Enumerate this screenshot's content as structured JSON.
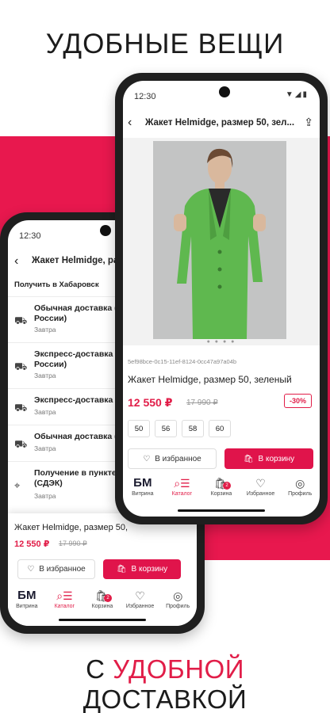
{
  "headline_top": "УДОБНЫЕ ВЕЩИ",
  "headline_bottom": {
    "prefix": "С ",
    "accent": "УДОБНОЙ",
    "suffix": " ДОСТАВКОЙ"
  },
  "colors": {
    "accent": "#e11d48",
    "band": "#e8184e"
  },
  "back_phone": {
    "time": "12:30",
    "title": "Жакет Helmidge, раз",
    "city": "Получить в Хабаровск",
    "delivery": [
      {
        "name": "Обычная доставка (\nРоссии)",
        "when": "Завтра",
        "icon": "truck-icon"
      },
      {
        "name": "Экспресс-доставка\nРоссии)",
        "when": "Завтра",
        "icon": "truck-icon"
      },
      {
        "name": "Экспресс-доставка",
        "when": "Завтра",
        "icon": "truck-icon"
      },
      {
        "name": "Обычная доставка (",
        "when": "Завтра",
        "icon": "truck-icon"
      },
      {
        "name": "Получение в пункте\n(СДЭК)",
        "when": "Завтра",
        "icon": "location-pin-icon"
      }
    ],
    "product_title": "Жакет Helmidge, размер 50,",
    "price": "12 550 ₽",
    "old_price": "17 990 ₽",
    "fav_label": "В избранное",
    "cart_label": "В корзину"
  },
  "front_phone": {
    "time": "12:30",
    "title": "Жакет Helmidge, размер 50, зел...",
    "sku": "5ef98bce-0c15-11ef-8124-0cc47a97a04b",
    "product_title": "Жакет Helmidge, размер 50, зеленый",
    "price": "12 550 ₽",
    "old_price": "17 990 ₽",
    "discount": "-30%",
    "sizes": [
      "50",
      "56",
      "58",
      "60"
    ],
    "fav_label": "В избранное",
    "cart_label": "В корзину"
  },
  "tabs": {
    "vitrina": "Витрина",
    "catalog": "Каталог",
    "cart": "Корзина",
    "cart_badge": "2",
    "favorites": "Избранное",
    "profile": "Профиль",
    "logo": "БМ"
  }
}
